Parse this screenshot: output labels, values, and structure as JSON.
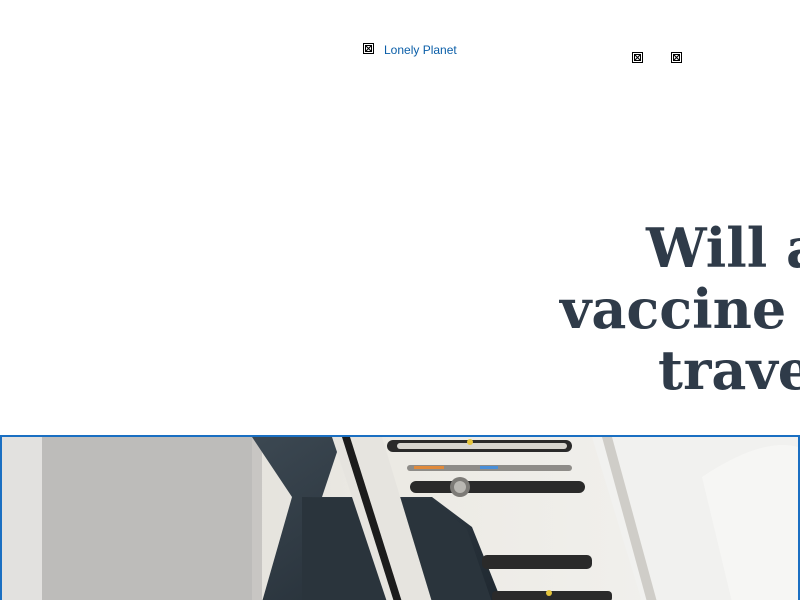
{
  "header": {
    "logo_alt": "Lonely Planet",
    "logo_icon": "broken-image-icon",
    "extra_icons": [
      "broken-image-icon",
      "broken-image-icon"
    ]
  },
  "article": {
    "headline_lines": [
      "Will a",
      "vaccine b",
      "travel"
    ]
  },
  "hero": {
    "description": "airplane cabin overhead panel",
    "border_color": "#1a6fc2"
  },
  "colors": {
    "link": "#0a5ea8",
    "headline": "#2f3b49"
  }
}
